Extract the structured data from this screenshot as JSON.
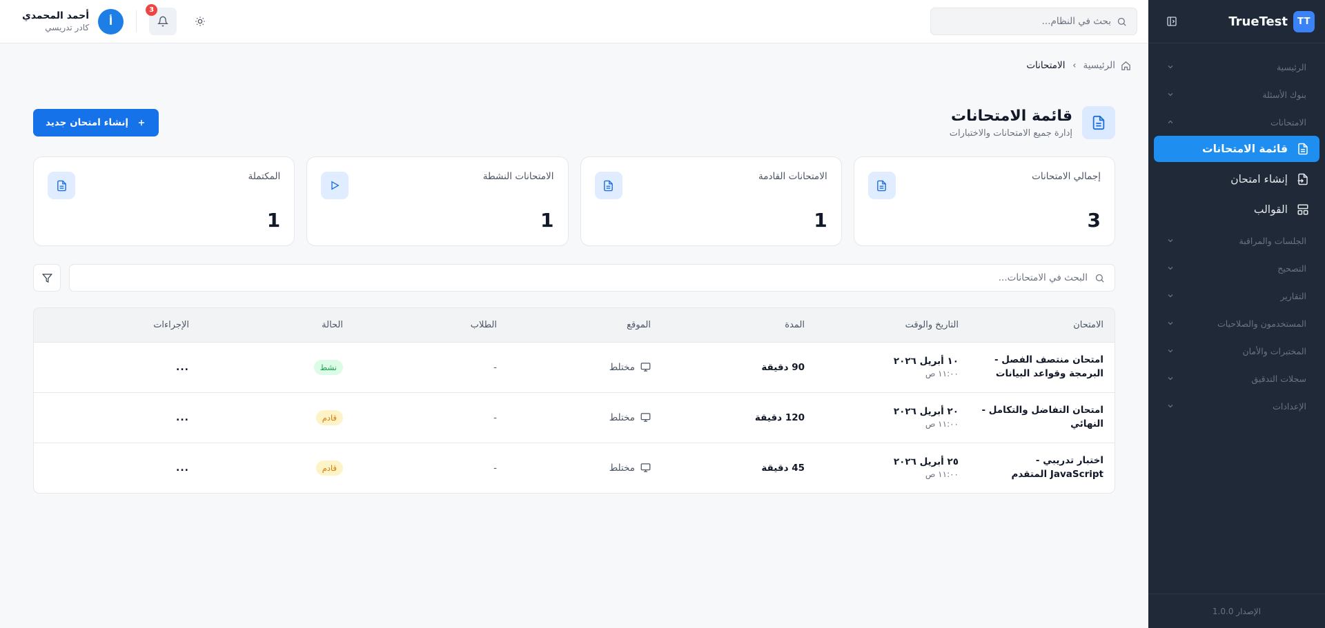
{
  "brand": {
    "badge": "TT",
    "name": "TrueTest"
  },
  "sidebar": {
    "groups": {
      "home": "الرئيسية",
      "banks": "بنوك الأسئلة",
      "exams": "الامتحانات",
      "sessions": "الجلسات والمراقبة",
      "grading": "التصحيح",
      "reports": "التقارير",
      "users": "المستخدمون والصلاحيات",
      "labs": "المختبرات والأمان",
      "audit": "سجلات التدقيق",
      "settings": "الإعدادات"
    },
    "items": {
      "exam_list": "قائمة الامتحانات",
      "create_exam": "إنشاء امتحان",
      "templates": "القوالب"
    },
    "version": "الإصدار 1.0.0"
  },
  "topbar": {
    "search_placeholder": "بحث في النظام...",
    "user_name": "أحمد المحمدي",
    "user_role": "كادر تدريسي",
    "avatar_letter": "أ",
    "notification_count": "3"
  },
  "breadcrumb": {
    "home": "الرئيسية",
    "current": "الامتحانات"
  },
  "page": {
    "title": "قائمة الامتحانات",
    "subtitle": "إدارة جميع الامتحانات والاختبارات",
    "create_button": "إنشاء امتحان جديد"
  },
  "stats": {
    "total": {
      "label": "إجمالي الامتحانات",
      "value": "3"
    },
    "upcoming": {
      "label": "الامتحانات القادمة",
      "value": "1"
    },
    "active": {
      "label": "الامتحانات النشطة",
      "value": "1"
    },
    "completed": {
      "label": "المكتملة",
      "value": "1"
    }
  },
  "table_search_placeholder": "البحث في الامتحانات...",
  "table": {
    "headers": {
      "exam": "الامتحان",
      "datetime": "التاريخ والوقت",
      "duration": "المدة",
      "location": "الموقع",
      "students": "الطلاب",
      "status": "الحالة",
      "actions": "الإجراءات"
    },
    "rows": [
      {
        "name": "امتحان منتصف الفصل - البرمجة وقواعد البيانات",
        "date": "١٠ أبريل ٢٠٢٦",
        "time": "١١:٠٠ ص",
        "duration": "90 دقيقة",
        "location": "مختلط",
        "students": "-",
        "status": "نشط",
        "actions": "..."
      },
      {
        "name": "امتحان التفاضل والتكامل - النهائي",
        "date": "٢٠ أبريل ٢٠٢٦",
        "time": "١١:٠٠ ص",
        "duration": "120 دقيقة",
        "location": "مختلط",
        "students": "-",
        "status": "قادم",
        "actions": "..."
      },
      {
        "name": "اختبار تدريبي - JavaScript المتقدم",
        "date": "٢٥ أبريل ٢٠٢٦",
        "time": "١١:٠٠ ص",
        "duration": "45 دقيقة",
        "location": "مختلط",
        "students": "-",
        "status": "قادم",
        "actions": "..."
      }
    ]
  },
  "colors": {
    "sidebar_bg": "#1f2937",
    "accent": "#1f8ef1",
    "primary_button": "#1572e8",
    "status_active": "#16a34a",
    "status_upcoming": "#d97706",
    "badge_red": "#ef4444"
  },
  "icons": {
    "brand": "tt-badge",
    "collapse": "sidebar-collapse-icon",
    "search": "search-icon",
    "bell": "bell-icon",
    "theme": "sun-icon",
    "home": "home-icon",
    "document": "document-icon",
    "play": "play-icon",
    "filter": "filter-icon",
    "monitor": "monitor-icon",
    "templates": "layout-icon",
    "file_import": "file-import-icon",
    "plus": "plus-icon",
    "chevron": "chevron-icon"
  }
}
